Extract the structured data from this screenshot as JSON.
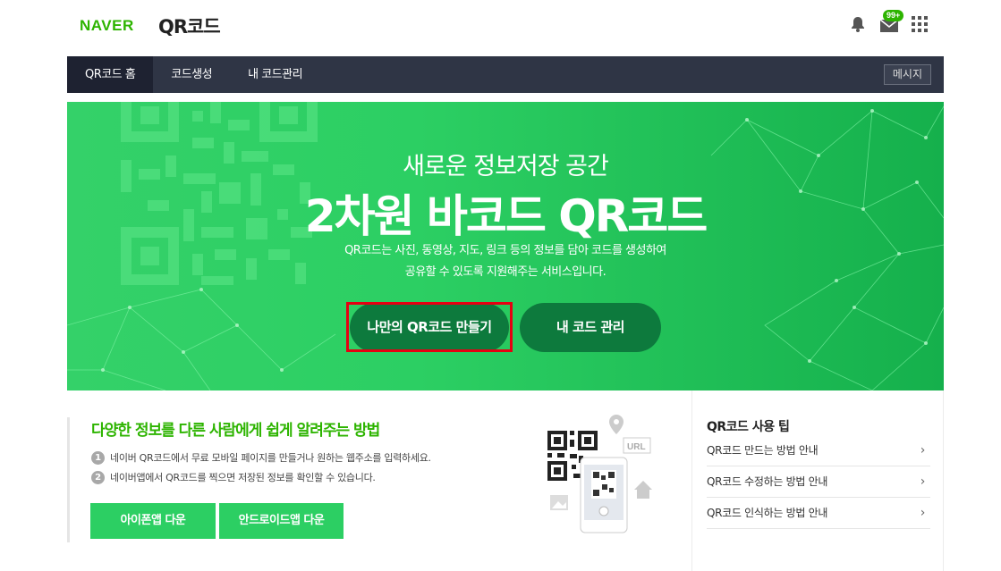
{
  "header": {
    "brand": "NAVER",
    "service": "QR코드",
    "mail_badge": "99+",
    "icons": [
      "bell-icon",
      "mail-icon",
      "apps-grid-icon"
    ]
  },
  "nav": {
    "items": [
      {
        "label": "QR코드 홈",
        "active": true
      },
      {
        "label": "코드생성",
        "active": false
      },
      {
        "label": "내 코드관리",
        "active": false
      }
    ],
    "message_button": "메시지"
  },
  "hero": {
    "subtitle": "새로운 정보저장 공간",
    "title": "2차원 바코드 QR코드",
    "desc_line1": "QR코드는 사진, 동영상, 지도, 링크 등의 정보를 담아 코드를 생성하여",
    "desc_line2": "공유할 수 있도록 지원해주는 서비스입니다.",
    "primary_button": "나만의 QR코드 만들기",
    "secondary_button": "내 코드 관리",
    "accent_color": "#2ccf63",
    "button_color": "#0d7a3d",
    "highlight_color": "#e60012"
  },
  "info": {
    "title": "다양한 정보를 다른 사람에게 쉽게 알려주는 방법",
    "steps": [
      {
        "num": "1",
        "text": "네이버 QR코드에서 무료 모바일 페이지를 만들거나 원하는 웹주소를 입력하세요."
      },
      {
        "num": "2",
        "text": "네이버앱에서 QR코드를 찍으면 저장된 정보를 확인할 수 있습니다."
      }
    ],
    "ios_button": "아이폰앱 다운",
    "android_button": "안드로이드앱 다운",
    "illustration_label": "URL"
  },
  "tips": {
    "title": "QR코드 사용 팁",
    "items": [
      "QR코드 만드는 방법 안내",
      "QR코드 수정하는 방법 안내",
      "QR코드 인식하는 방법 안내"
    ]
  }
}
